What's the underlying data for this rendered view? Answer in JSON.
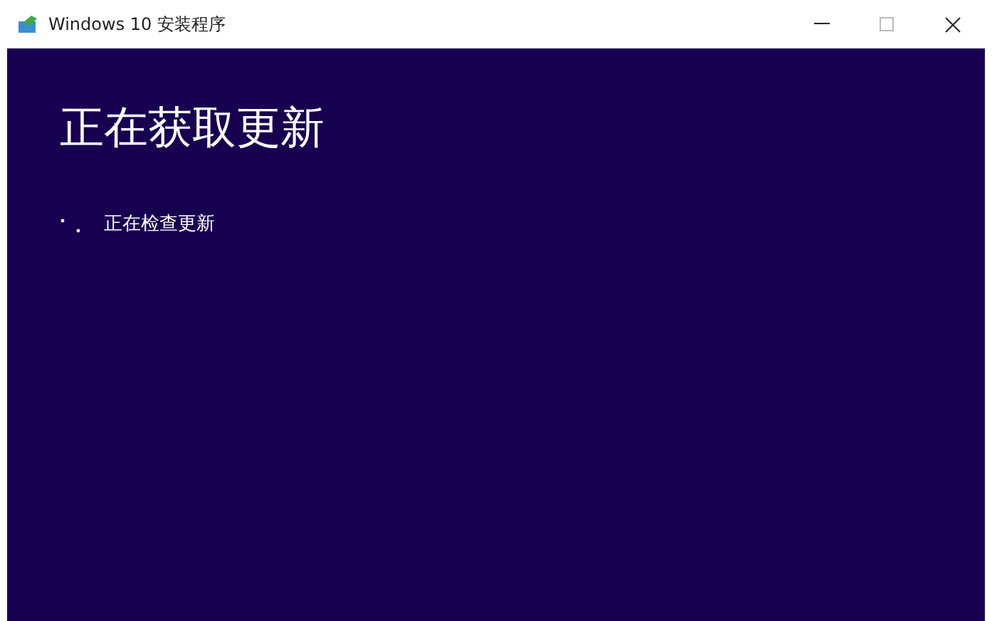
{
  "window": {
    "title": "Windows 10 安装程序"
  },
  "heading": "正在获取更新",
  "status": "正在检查更新"
}
